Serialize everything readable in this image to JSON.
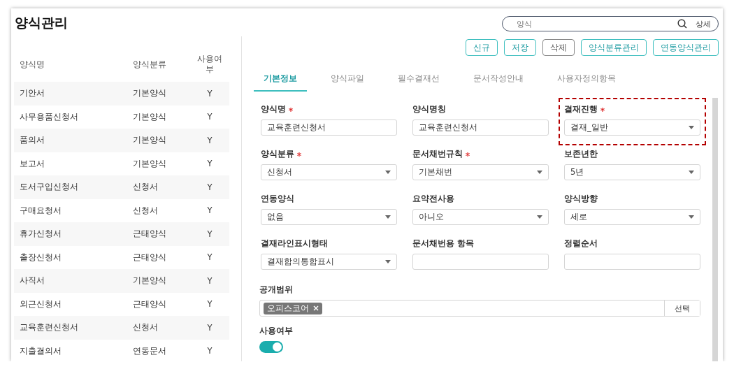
{
  "title": "양식관리",
  "search": {
    "placeholder": "양식",
    "detail_button": "상세"
  },
  "list": {
    "columns": [
      "양식명",
      "양식분류",
      "사용여부"
    ],
    "rows": [
      {
        "cells": [
          "기안서",
          "기본양식",
          "Y"
        ]
      },
      {
        "cells": [
          "사무용품신청서",
          "기본양식",
          "Y"
        ]
      },
      {
        "cells": [
          "품의서",
          "기본양식",
          "Y"
        ]
      },
      {
        "cells": [
          "보고서",
          "기본양식",
          "Y"
        ]
      },
      {
        "cells": [
          "도서구입신청서",
          "신청서",
          "Y"
        ]
      },
      {
        "cells": [
          "구매요청서",
          "신청서",
          "Y"
        ]
      },
      {
        "cells": [
          "휴가신청서",
          "근태양식",
          "Y"
        ]
      },
      {
        "cells": [
          "출장신청서",
          "근태양식",
          "Y"
        ]
      },
      {
        "cells": [
          "사직서",
          "기본양식",
          "Y"
        ]
      },
      {
        "cells": [
          "외근신청서",
          "근태양식",
          "Y"
        ]
      },
      {
        "cells": [
          "교육훈련신청서",
          "신청서",
          "Y"
        ]
      },
      {
        "cells": [
          "지출결의서",
          "연동문서",
          "Y"
        ]
      }
    ]
  },
  "toolbar": [
    {
      "label": "신규",
      "kind": "primary"
    },
    {
      "label": "저장",
      "kind": "primary"
    },
    {
      "label": "삭제",
      "kind": "neutral"
    },
    {
      "label": "양식분류관리",
      "kind": "primary"
    },
    {
      "label": "연동양식관리",
      "kind": "primary"
    }
  ],
  "tabs": [
    {
      "label": "기본정보",
      "selected": true
    },
    {
      "label": "양식파일",
      "selected": false
    },
    {
      "label": "필수결재선",
      "selected": false
    },
    {
      "label": "문서작성안내",
      "selected": false
    },
    {
      "label": "사용자정의항목",
      "selected": false
    }
  ],
  "fields": [
    {
      "label": "양식명",
      "required": true,
      "kind": "text",
      "value": "교육훈련신청서",
      "highlighted": false
    },
    {
      "label": "양식명칭",
      "required": false,
      "kind": "text",
      "value": "교육훈련신청서",
      "highlighted": false
    },
    {
      "label": "결재진행",
      "required": true,
      "kind": "select",
      "value": "결재_일반",
      "highlighted": true
    },
    {
      "label": "양식분류",
      "required": true,
      "kind": "select",
      "value": "신청서",
      "highlighted": false
    },
    {
      "label": "문서채번규칙",
      "required": true,
      "kind": "select",
      "value": "기본채번",
      "highlighted": false
    },
    {
      "label": "보존년한",
      "required": false,
      "kind": "select",
      "value": "5년",
      "highlighted": false
    },
    {
      "label": "연동양식",
      "required": false,
      "kind": "select",
      "value": "없음",
      "highlighted": false
    },
    {
      "label": "요약전사용",
      "required": false,
      "kind": "select",
      "value": "아니오",
      "highlighted": false
    },
    {
      "label": "양식방향",
      "required": false,
      "kind": "select",
      "value": "세로",
      "highlighted": false
    },
    {
      "label": "결재라인표시형태",
      "required": false,
      "kind": "select",
      "value": "결재합의통합표시",
      "highlighted": false
    },
    {
      "label": "문서채번용 항목",
      "required": false,
      "kind": "text",
      "highlighted": false
    },
    {
      "label": "정렬순서",
      "required": false,
      "kind": "text",
      "highlighted": false
    }
  ],
  "scope": {
    "label": "공개범위",
    "tags": [
      "오피스코어"
    ],
    "button": "선택"
  },
  "usage": {
    "label": "사용여부",
    "on": true
  }
}
